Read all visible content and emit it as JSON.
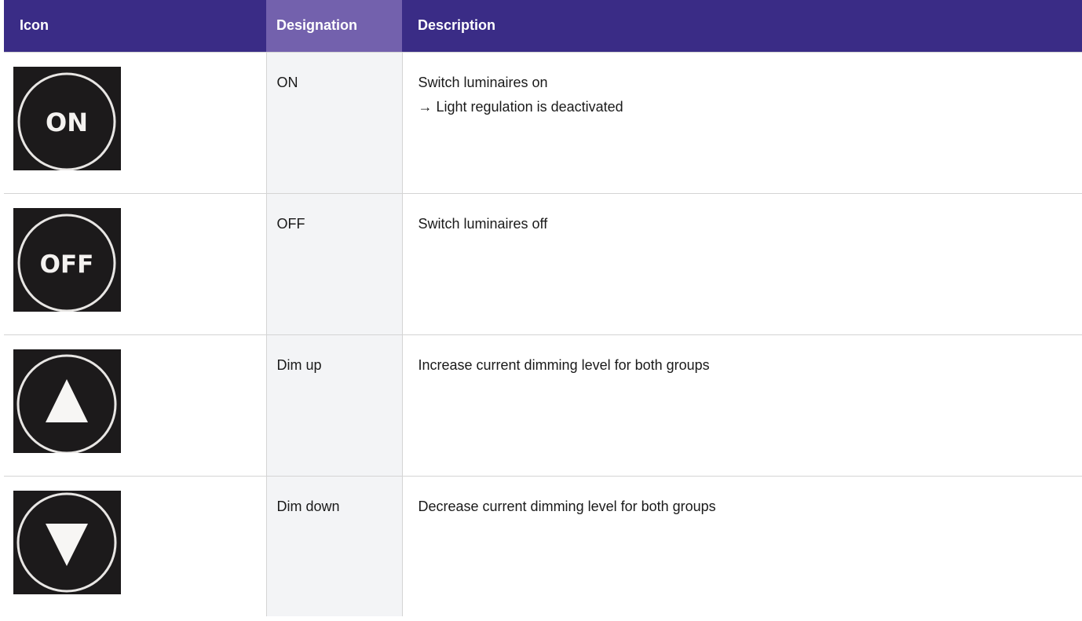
{
  "table": {
    "headers": {
      "icon": "Icon",
      "designation": "Designation",
      "description": "Description"
    },
    "rows": [
      {
        "icon": "on-button-icon",
        "icon_text": "ON",
        "designation": "ON",
        "description": "Switch luminaires on",
        "description_note": "→ Light regulation is deactivated"
      },
      {
        "icon": "off-button-icon",
        "icon_text": "OFF",
        "designation": "OFF",
        "description": "Switch luminaires off"
      },
      {
        "icon": "dim-up-icon",
        "designation": "Dim up",
        "description": "Increase current dimming level for both groups"
      },
      {
        "icon": "dim-down-icon",
        "designation": "Dim down",
        "description": "Decrease current dimming level for both groups"
      }
    ]
  },
  "colors": {
    "header_bg": "#3a2c86",
    "header_highlight_bg": "#7361ad",
    "designation_column_bg": "#f3f4f6",
    "icon_bg": "#1c1a1b"
  }
}
